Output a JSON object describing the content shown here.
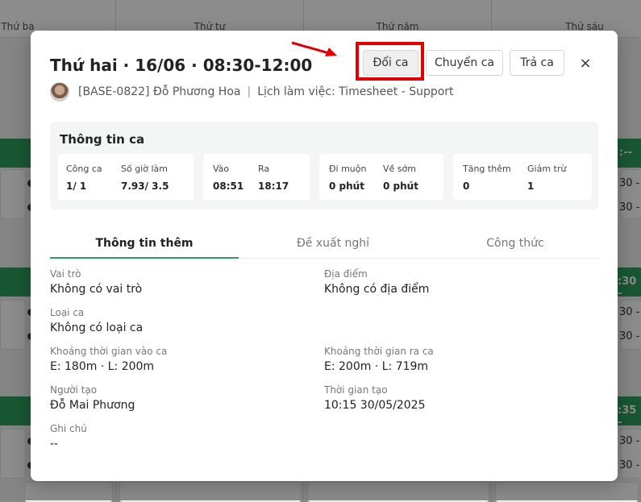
{
  "background": {
    "days": [
      "Thứ ba",
      "Thứ tư",
      "Thứ năm",
      "Thứ sáu"
    ],
    "right_times": [
      ":--",
      "30 -",
      "30 -",
      ":30 -",
      "30 -",
      "30 -",
      ":35 -",
      "30 -",
      "30 -"
    ],
    "brand_color": "#2e9e5b"
  },
  "modal": {
    "title": "Thứ hai · 16/06 · 08:30-12:00",
    "buttons": {
      "swap": "Đổi ca",
      "transfer": "Chuyển ca",
      "return": "Trả ca"
    },
    "close_icon": "×",
    "employee": {
      "code_name": "[BASE-0822] Đỗ Phương Hoa",
      "schedule": "Lịch làm việc: Timesheet - Support"
    },
    "shift_info": {
      "title": "Thông tin ca",
      "groups": [
        {
          "items": [
            {
              "label": "Công ca",
              "value": "1/ 1"
            },
            {
              "label": "Số giờ làm",
              "value": "7.93/ 3.5"
            }
          ]
        },
        {
          "items": [
            {
              "label": "Vào",
              "value": "08:51"
            },
            {
              "label": "Ra",
              "value": "18:17"
            }
          ]
        },
        {
          "items": [
            {
              "label": "Đi muộn",
              "value": "0 phút"
            },
            {
              "label": "Về sớm",
              "value": "0 phút"
            }
          ]
        },
        {
          "items": [
            {
              "label": "Tăng thêm",
              "value": "0"
            },
            {
              "label": "Giảm trừ",
              "value": "1"
            }
          ]
        }
      ]
    },
    "tabs": [
      "Thông tin thêm",
      "Đề xuất nghỉ",
      "Công thức"
    ],
    "details": {
      "role": {
        "label": "Vai trò",
        "value": "Không có vai trò"
      },
      "location": {
        "label": "Địa điểm",
        "value": "Không có địa điểm"
      },
      "shift_type": {
        "label": "Loại ca",
        "value": "Không có loại ca"
      },
      "checkin_window": {
        "label": "Khoảng thời gian vào ca",
        "value": "E: 180m · L: 200m"
      },
      "checkout_window": {
        "label": "Khoảng thời gian ra ca",
        "value": "E: 200m · L: 719m"
      },
      "creator": {
        "label": "Người tạo",
        "value": "Đỗ Mai Phương"
      },
      "created_at": {
        "label": "Thời gian tạo",
        "value": "10:15 30/05/2025"
      },
      "note": {
        "label": "Ghi chú",
        "value": "--"
      }
    },
    "annotation_color": "#e30000"
  }
}
